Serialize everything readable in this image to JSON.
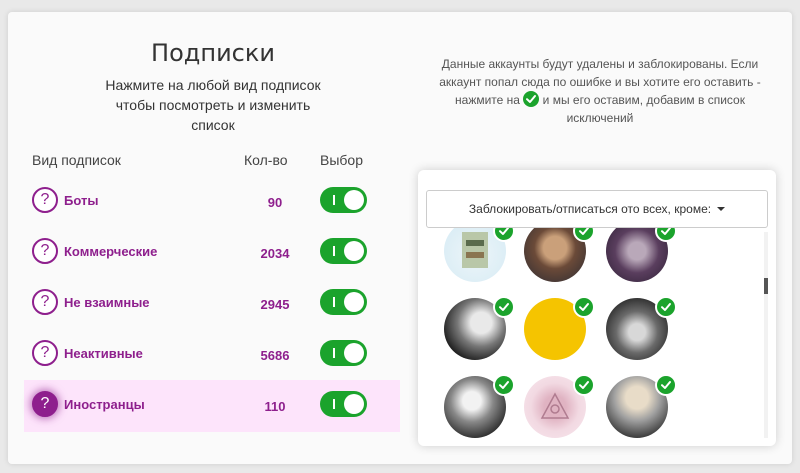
{
  "header": {
    "title": "Подписки",
    "subtitle": "Нажмите на любой вид подписок чтобы посмотреть и изменить список"
  },
  "table": {
    "headers": {
      "type": "Вид подписок",
      "count": "Кол-во",
      "choice": "Выбор"
    },
    "rows": [
      {
        "label": "Боты",
        "count": "90",
        "enabled": true,
        "selected": false
      },
      {
        "label": "Коммерческие",
        "count": "2034",
        "enabled": true,
        "selected": false
      },
      {
        "label": "Не взаимные",
        "count": "2945",
        "enabled": true,
        "selected": false
      },
      {
        "label": "Неактивные",
        "count": "5686",
        "enabled": true,
        "selected": false
      },
      {
        "label": "Иностранцы",
        "count": "110",
        "enabled": true,
        "selected": true
      }
    ],
    "help_glyph": "?"
  },
  "info": {
    "text_before": "Данные аккаунты будут удалены и заблокированы. Если аккаунт попал сюда по ошибке и вы хотите его оставить - нажмите на",
    "text_after": "и мы его оставим, добавим в список исключений"
  },
  "panel": {
    "dropdown_label": "Заблокировать/отписаться ото всех, кроме:"
  },
  "avatars": [
    {
      "name": "avatar-1",
      "checked": true
    },
    {
      "name": "avatar-2",
      "checked": true
    },
    {
      "name": "avatar-3",
      "checked": true
    },
    {
      "name": "avatar-4",
      "checked": true
    },
    {
      "name": "avatar-5",
      "checked": true
    },
    {
      "name": "avatar-6",
      "checked": true
    },
    {
      "name": "avatar-7",
      "checked": true
    },
    {
      "name": "avatar-8",
      "checked": true
    },
    {
      "name": "avatar-9",
      "checked": true
    }
  ],
  "colors": {
    "accent": "#8e1f8d",
    "toggle_on": "#1ba32c",
    "selected_row": "#fde4fb"
  }
}
